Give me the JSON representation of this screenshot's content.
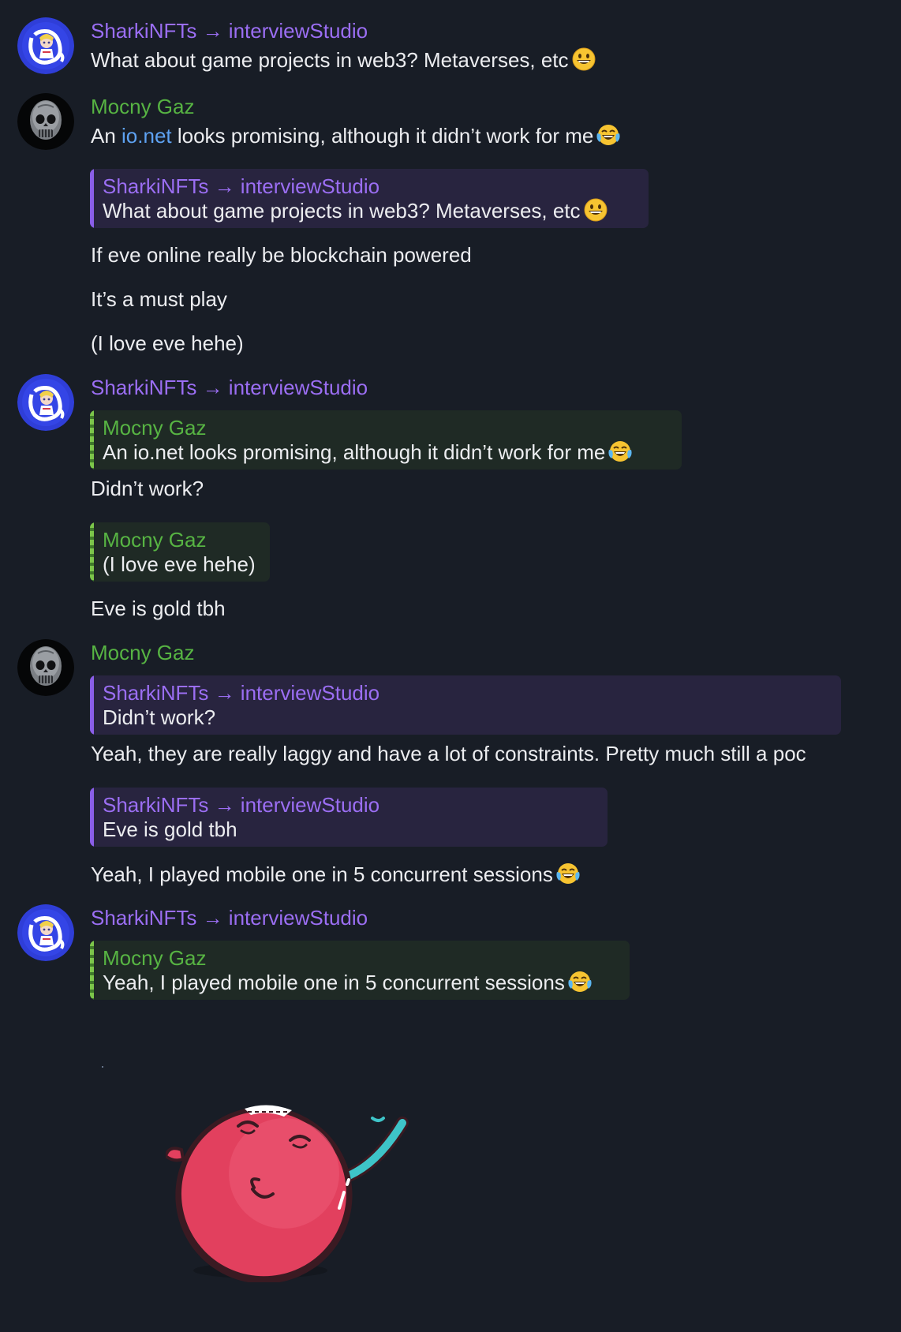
{
  "users": {
    "sharki": "SharkiNFTs → interviewStudio",
    "mocny": "Mocny Gaz"
  },
  "colors": {
    "background": "#181d26",
    "sharki_name": "#9b6ef3",
    "mocny_name": "#57b443",
    "link": "#5ea2f2"
  },
  "messages": {
    "m1": {
      "sender": "SharkiNFTs → interviewStudio",
      "text": "What about game projects in web3? Metaverses, etc",
      "emoji": "grinning-face-emoji"
    },
    "m2": {
      "sender": "Mocny Gaz",
      "prefix": "An ",
      "link": "io.net",
      "suffix": " looks promising, although it didn’t work for me",
      "emoji": "tears-of-joy-emoji"
    },
    "m3": {
      "reply_name": "SharkiNFTs → interviewStudio",
      "reply_text": "What about game projects in web3? Metaverses, etc",
      "text": "If eve online really be blockchain powered"
    },
    "m4": {
      "text": "It’s a must play"
    },
    "m5": {
      "text": "(I love eve hehe)"
    },
    "m6": {
      "sender": "SharkiNFTs → interviewStudio",
      "reply_name": "Mocny Gaz",
      "reply_text": "An io.net looks promising, although it didn’t work for me",
      "text": "Didn’t work?"
    },
    "m7": {
      "reply_name": "Mocny Gaz",
      "reply_text": "(I love eve hehe)",
      "text": "Eve is gold tbh"
    },
    "m8": {
      "sender": "Mocny Gaz",
      "reply_name": "SharkiNFTs → interviewStudio",
      "reply_text": "Didn’t work?",
      "text": "Yeah, they are really laggy and have a lot of constraints. Pretty much still a poc"
    },
    "m9": {
      "reply_name": "SharkiNFTs → interviewStudio",
      "reply_text": "Eve is gold tbh",
      "text": "Yeah, I played mobile one in 5 concurrent sessions"
    },
    "m10": {
      "sender": "SharkiNFTs → interviewStudio",
      "reply_name": "Mocny Gaz",
      "reply_text": "Yeah, I played mobile one in 5 concurrent sessions",
      "sticker": "laughing-pink-ball-sticker"
    }
  }
}
